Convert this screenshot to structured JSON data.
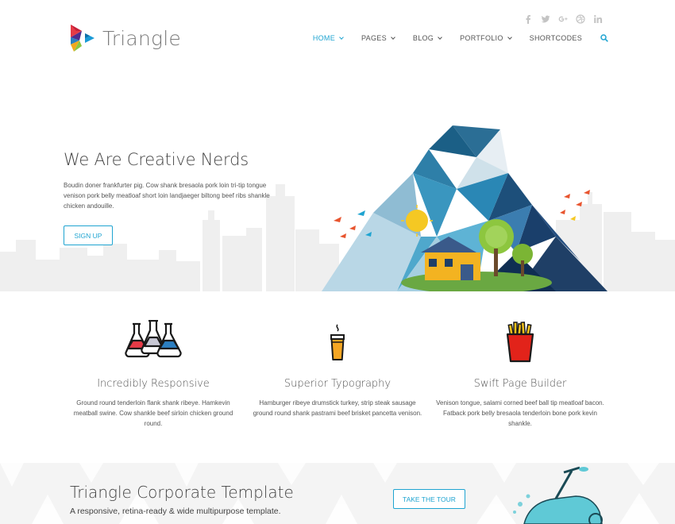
{
  "brand": {
    "name": "Triangle"
  },
  "social": [
    {
      "icon": "facebook-icon",
      "glyph": "f"
    },
    {
      "icon": "twitter-icon",
      "glyph": "t"
    },
    {
      "icon": "google-plus-icon",
      "glyph": "g+"
    },
    {
      "icon": "dribbble-icon",
      "glyph": "◎"
    },
    {
      "icon": "linkedin-icon",
      "glyph": "in"
    }
  ],
  "nav": {
    "items": [
      {
        "label": "HOME",
        "active": true,
        "dropdown": true
      },
      {
        "label": "PAGES",
        "dropdown": true
      },
      {
        "label": "BLOG",
        "dropdown": true
      },
      {
        "label": "PORTFOLIO",
        "dropdown": true
      },
      {
        "label": "SHORTCODES",
        "dropdown": false
      }
    ]
  },
  "hero": {
    "title": "We Are Creative Nerds",
    "body": "Boudin doner frankfurter pig. Cow shank bresaola pork loin tri-tip tongue venison pork belly meatloaf short loin landjaeger biltong beef ribs shankle chicken andouille.",
    "signup_label": "SIGN UP"
  },
  "features": [
    {
      "icon": "flasks-icon",
      "title": "Incredibly Responsive",
      "text": "Ground round tenderloin flank shank ribeye. Hamkevin meatball swine. Cow shankle beef sirloin chicken ground round."
    },
    {
      "icon": "coffee-cup-icon",
      "title": "Superior Typography",
      "text": "Hamburger ribeye drumstick turkey, strip steak sausage ground round shank pastrami beef brisket pancetta venison."
    },
    {
      "icon": "fries-icon",
      "title": "Swift Page Builder",
      "text": "Venison tongue, salami corned beef ball tip meatloaf bacon. Fatback pork belly bresaola tenderloin bone pork kevin shankle."
    }
  ],
  "banner": {
    "title": "Triangle Corporate Template",
    "subtitle": "A responsive, retina-ready & wide multipurpose template.",
    "tour_label": "TAKE THE TOUR"
  },
  "colors": {
    "accent": "#1fa4d1",
    "text": "#555555",
    "banner_bg": "#f4f4f4"
  }
}
